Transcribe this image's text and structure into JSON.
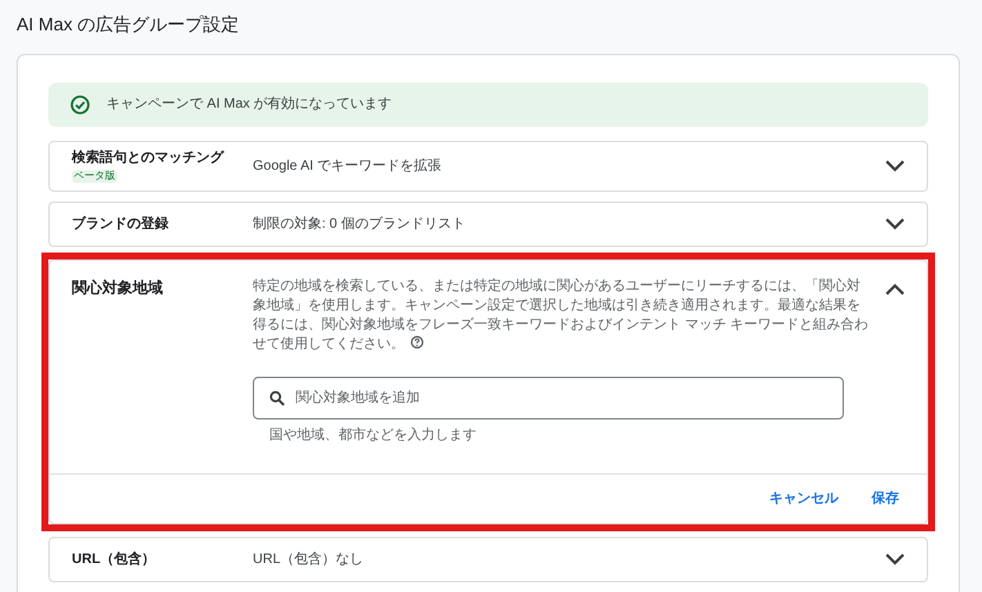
{
  "title": "AI Max の広告グループ設定",
  "banner": {
    "text": "キャンペーンで AI Max が有効になっています"
  },
  "rows": [
    {
      "label": "検索語句とのマッチング",
      "badge": "ベータ版",
      "value": "Google AI でキーワードを拡張",
      "expanded": false,
      "highlighted": false
    },
    {
      "label": "ブランドの登録",
      "value": "制限の対象: 0 個のブランドリスト",
      "expanded": false,
      "highlighted": false
    },
    {
      "label": "関心対象地域",
      "description": "特定の地域を検索している、または特定の地域に関心があるユーザーにリーチするには、「関心対象地域」を使用します。キャンペーン設定で選択した地域は引き続き適用されます。最適な結果を得るには、関心対象地域をフレーズ一致キーワードおよびインテント マッチ キーワードと組み合わせて使用してください。",
      "search": {
        "placeholder": "関心対象地域を追加"
      },
      "hint": "国や地域、都市などを入力します",
      "buttons": [
        "キャンセル",
        "保存"
      ],
      "expanded": true,
      "highlighted": true
    },
    {
      "label": "URL（包含）",
      "value": "URL（包含）なし",
      "expanded": false,
      "highlighted": false
    }
  ]
}
